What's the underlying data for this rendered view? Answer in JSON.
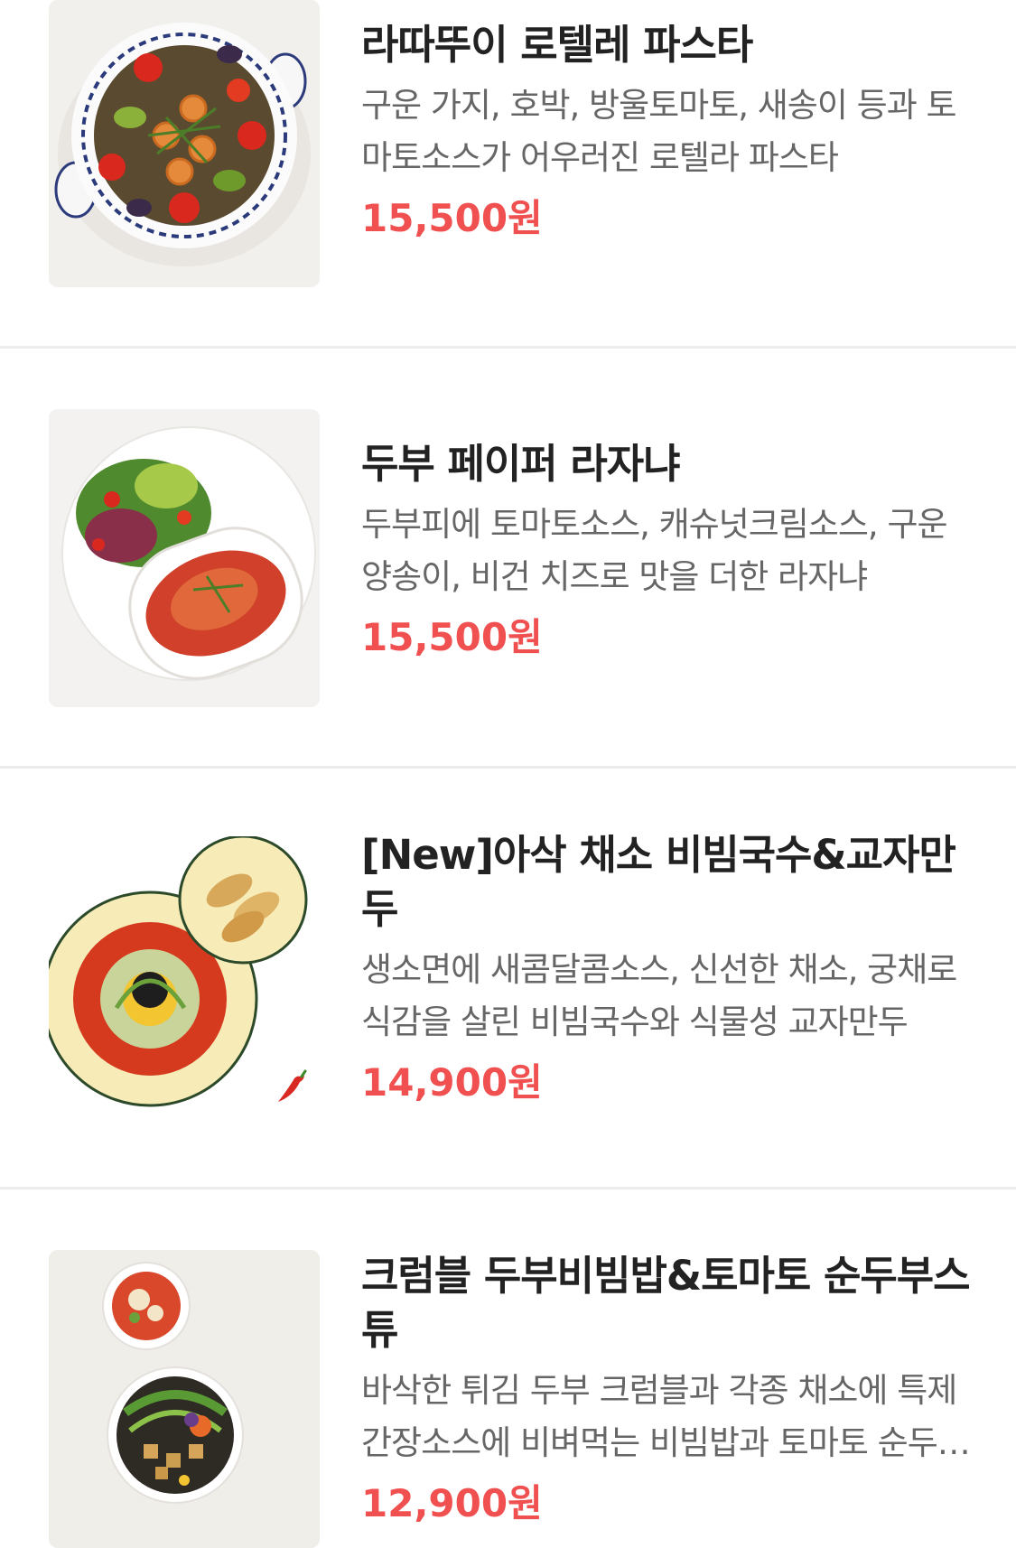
{
  "menu": {
    "items": [
      {
        "name": "라따뚜이 로텔레 파스타",
        "description": "구운 가지, 호박, 방울토마토, 새송이 등과 토마토소스가 어우러진 로텔라 파스타",
        "price": "15,500원",
        "image_icon": "ratatouille-pasta-image"
      },
      {
        "name": "두부 페이퍼 라자냐",
        "description": "두부피에 토마토소스, 캐슈넛크림소스, 구운양송이, 비건 치즈로 맛을 더한 라자냐",
        "price": "15,500원",
        "image_icon": "tofu-lasagna-image"
      },
      {
        "name": "[New]아삭 채소 비빔국수&교자만두",
        "description": "생소면에 새콤달콤소스, 신선한 채소, 궁채로 식감을 살린 비빔국수와 식물성 교자만두",
        "price": "14,900원",
        "image_icon": "bibim-noodle-gyoza-image",
        "badge_icon": "chili-pepper-icon"
      },
      {
        "name": "크럼블 두부비빔밥&토마토 순두부스튜",
        "description": "바삭한 튀김 두부 크럼블과 각종 채소에 특제 간장소스에 비벼먹는 비빔밥과 토마토 순두부스튜",
        "price": "12,900원",
        "image_icon": "tofu-bibimbap-stew-image"
      }
    ]
  },
  "colors": {
    "price": "#f0504f",
    "title": "#222222",
    "description": "#666666",
    "divider": "#ececec"
  }
}
